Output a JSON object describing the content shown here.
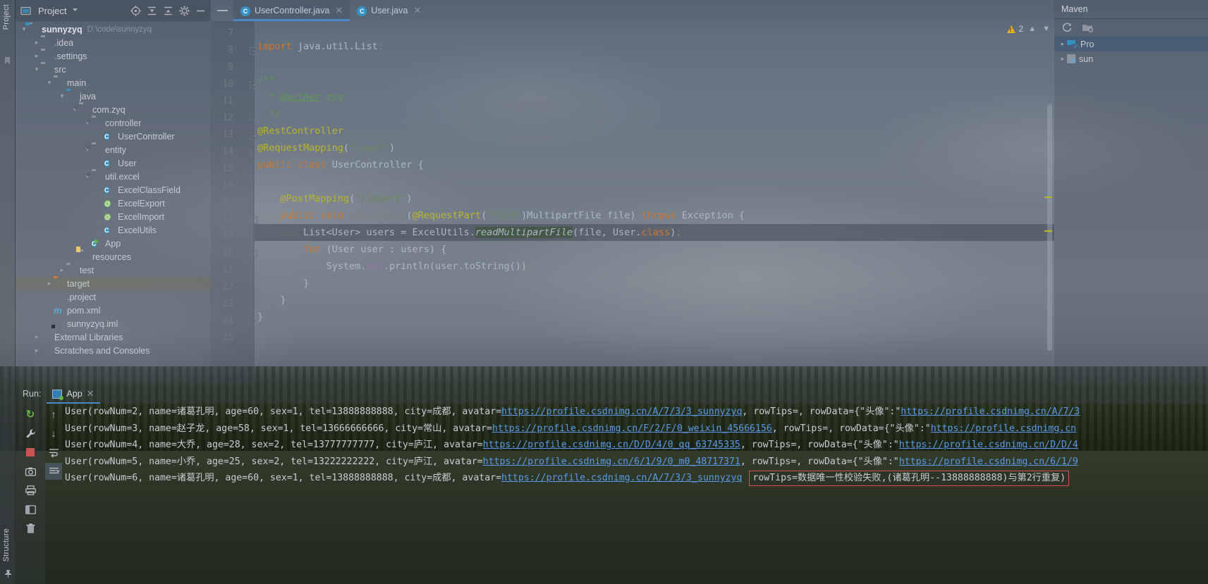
{
  "left_strip": {
    "project_label": "Project",
    "structure_label": "Structure"
  },
  "project_panel": {
    "title": "Project",
    "icons": [
      "project-view-icon",
      "dropdown-arrow-icon",
      "locate-icon",
      "expand-all-icon",
      "collapse-all-icon",
      "settings-gear-icon",
      "hide-icon"
    ],
    "tree": [
      {
        "label": "sunnyzyq",
        "path": "D:\\code\\sunnyzyq",
        "indent": 0,
        "arrow": "v",
        "icon": "module-folder-icon",
        "bold": true
      },
      {
        "label": ".idea",
        "path": "",
        "indent": 1,
        "arrow": ">",
        "icon": "folder-icon",
        "bold": false
      },
      {
        "label": ".settings",
        "path": "",
        "indent": 1,
        "arrow": ">",
        "icon": "folder-icon",
        "bold": false
      },
      {
        "label": "src",
        "path": "",
        "indent": 1,
        "arrow": "v",
        "icon": "folder-icon",
        "bold": false
      },
      {
        "label": "main",
        "path": "",
        "indent": 2,
        "arrow": "v",
        "icon": "folder-icon",
        "bold": false
      },
      {
        "label": "java",
        "path": "",
        "indent": 3,
        "arrow": "v",
        "icon": "source-folder-icon",
        "bold": false
      },
      {
        "label": "com.zyq",
        "path": "",
        "indent": 4,
        "arrow": "v",
        "icon": "package-icon",
        "bold": false
      },
      {
        "label": "controller",
        "path": "",
        "indent": 5,
        "arrow": "v",
        "icon": "package-icon",
        "bold": false
      },
      {
        "label": "UserController",
        "path": "",
        "indent": 6,
        "arrow": "",
        "icon": "java-class-icon",
        "bold": false
      },
      {
        "label": "entity",
        "path": "",
        "indent": 5,
        "arrow": "v",
        "icon": "package-icon",
        "bold": false
      },
      {
        "label": "User",
        "path": "",
        "indent": 6,
        "arrow": "",
        "icon": "java-class-icon",
        "bold": false
      },
      {
        "label": "util.excel",
        "path": "",
        "indent": 5,
        "arrow": "v",
        "icon": "package-icon",
        "bold": false
      },
      {
        "label": "ExcelClassField",
        "path": "",
        "indent": 6,
        "arrow": "",
        "icon": "java-class-icon",
        "bold": false
      },
      {
        "label": "ExcelExport",
        "path": "",
        "indent": 6,
        "arrow": "",
        "icon": "java-annotation-icon",
        "bold": false
      },
      {
        "label": "ExcelImport",
        "path": "",
        "indent": 6,
        "arrow": "",
        "icon": "java-annotation-icon",
        "bold": false
      },
      {
        "label": "ExcelUtils",
        "path": "",
        "indent": 6,
        "arrow": "",
        "icon": "java-class-icon",
        "bold": false
      },
      {
        "label": "App",
        "path": "",
        "indent": 5,
        "arrow": "",
        "icon": "runnable-class-icon",
        "bold": false
      },
      {
        "label": "resources",
        "path": "",
        "indent": 4,
        "arrow": "",
        "icon": "resources-folder-icon",
        "bold": false
      },
      {
        "label": "test",
        "path": "",
        "indent": 3,
        "arrow": ">",
        "icon": "folder-icon",
        "bold": false
      },
      {
        "label": "target",
        "path": "",
        "indent": 2,
        "arrow": ">",
        "icon": "excluded-folder-icon",
        "bold": false,
        "selected": true
      },
      {
        "label": ".project",
        "path": "",
        "indent": 2,
        "arrow": "",
        "icon": "project-file-icon",
        "bold": false
      },
      {
        "label": "pom.xml",
        "path": "",
        "indent": 2,
        "arrow": "",
        "icon": "maven-file-icon",
        "bold": false
      },
      {
        "label": "sunnyzyq.iml",
        "path": "",
        "indent": 2,
        "arrow": "",
        "icon": "iml-file-icon",
        "bold": false
      },
      {
        "label": "External Libraries",
        "path": "",
        "indent": 1,
        "arrow": ">",
        "icon": "libraries-icon",
        "bold": false
      },
      {
        "label": "Scratches and Consoles",
        "path": "",
        "indent": 1,
        "arrow": ">",
        "icon": "scratches-icon",
        "bold": false
      }
    ]
  },
  "editor": {
    "tabs": [
      {
        "label": "UserController.java",
        "icon": "java-class-icon",
        "active": true
      },
      {
        "label": "User.java",
        "icon": "java-class-icon",
        "active": false
      }
    ],
    "inspection": {
      "count": "2",
      "icon": "warning-triangle-icon"
    },
    "first_line_number": 7,
    "lines": [
      {
        "n": 7,
        "fold": "",
        "html": ""
      },
      {
        "n": 8,
        "fold": "t",
        "html": "<span class=\"kw\">import</span> java.util.List<span class=\"dim\">;</span>"
      },
      {
        "n": 9,
        "fold": "",
        "html": ""
      },
      {
        "n": 10,
        "fold": "t",
        "html": "<span class=\"cmt\">/**</span>"
      },
      {
        "n": 11,
        "fold": "",
        "html": "  <span class=\"cmt\">* </span><span class=\"lnk\">@author</span><span class=\"cmt\"> <i>zyq</i></span>"
      },
      {
        "n": 12,
        "fold": "b",
        "html": "  <span class=\"cmt\">*/</span>"
      },
      {
        "n": 13,
        "fold": "t",
        "html": "<span class=\"ann\">@RestController</span>"
      },
      {
        "n": 14,
        "fold": "b",
        "html": "<span class=\"ann\">@RequestMapping</span>(<span class=\"str\">\"/user\"</span>)"
      },
      {
        "n": 15,
        "fold": "",
        "html": "<span class=\"kw\">public</span> <span class=\"kw\">class</span> <span class=\"typ\">UserController</span> {"
      },
      {
        "n": 16,
        "fold": "",
        "html": ""
      },
      {
        "n": 17,
        "fold": "",
        "html": "    <span class=\"ann\">@PostMapping</span>(<span class=\"str\">\"/import\"</span>)"
      },
      {
        "n": 18,
        "fold": "t",
        "html": "    <span class=\"kw\">public</span> <span class=\"kw\">void</span> <span class=\"dim\">importUser</span>(<span class=\"ann\">@RequestPart</span>(<span class=\"str\">\"file\"</span>)MultipartFile file) <span class=\"kw\">throws</span> Exception {"
      },
      {
        "n": 19,
        "fold": "",
        "cur": true,
        "html": "        List&lt;User&gt; users = ExcelUtils.<span class=\"sh\">readMultipartFile</span>(file, User.<span class=\"kw\">class</span>)<span class=\"dim\">;</span>"
      },
      {
        "n": 20,
        "fold": "t",
        "html": "        <span class=\"kw\">for</span> (User user : users) {"
      },
      {
        "n": 21,
        "fold": "",
        "html": "            System.<span class=\"fld\">out</span>.println(user.toString())<span class=\"dim\">;</span>"
      },
      {
        "n": 22,
        "fold": "b",
        "html": "        }"
      },
      {
        "n": 23,
        "fold": "b",
        "html": "    }"
      },
      {
        "n": 24,
        "fold": "",
        "html": "}"
      },
      {
        "n": 25,
        "fold": "",
        "html": ""
      }
    ]
  },
  "maven_panel": {
    "title": "Maven",
    "toolbar_icons": [
      "refresh-icon",
      "add-maven-project-icon"
    ],
    "items": [
      {
        "label": "Pro",
        "icon": "maven-profiles-icon",
        "arrow": ">",
        "selected": true
      },
      {
        "label": "sun",
        "icon": "maven-module-icon",
        "arrow": ">",
        "selected": false
      }
    ]
  },
  "run_panel": {
    "label": "Run:",
    "tab": {
      "label": "App",
      "icon": "run-config-icon"
    },
    "toolbar_icons": [
      "rerun-icon",
      "settings-wrench-icon",
      "stop-icon",
      "camera-icon",
      "export-icon",
      "print-icon",
      "layout-icon",
      "trash-icon",
      "scroll-up-icon",
      "scroll-down-icon",
      "soft-wrap-icon",
      "scroll-to-end-icon"
    ],
    "console_lines": [
      {
        "segments": [
          {
            "t": "User(rowNum=2, name=诸葛孔明, age=60, sex=1, tel=13888888888, city=成都, avatar=",
            "k": "text"
          },
          {
            "t": "https://profile.csdnimg.cn/A/7/3/3_sunnyzyq",
            "k": "link"
          },
          {
            "t": ", rowTips=, rowData={\"头像\":\"",
            "k": "text"
          },
          {
            "t": "https://profile.csdnimg.cn/A/7/3",
            "k": "link"
          }
        ]
      },
      {
        "segments": [
          {
            "t": "User(rowNum=3, name=赵子龙, age=58, sex=1, tel=13666666666, city=常山, avatar=",
            "k": "text"
          },
          {
            "t": "https://profile.csdnimg.cn/F/2/F/0_weixin_45666156",
            "k": "link"
          },
          {
            "t": ", rowTips=, rowData={\"头像\":\"",
            "k": "text"
          },
          {
            "t": "https://profile.csdnimg.cn",
            "k": "link"
          }
        ]
      },
      {
        "segments": [
          {
            "t": "User(rowNum=4, name=大乔, age=28, sex=2, tel=13777777777, city=庐江, avatar=",
            "k": "text"
          },
          {
            "t": "https://profile.csdnimg.cn/D/D/4/0_qq_63745335",
            "k": "link"
          },
          {
            "t": ", rowTips=, rowData={\"头像\":\"",
            "k": "text"
          },
          {
            "t": "https://profile.csdnimg.cn/D/D/4",
            "k": "link"
          }
        ]
      },
      {
        "segments": [
          {
            "t": "User(rowNum=5, name=小乔, age=25, sex=2, tel=13222222222, city=庐江, avatar=",
            "k": "text"
          },
          {
            "t": "https://profile.csdnimg.cn/6/1/9/0_m0_48717371",
            "k": "link"
          },
          {
            "t": ", rowTips=, rowData={\"头像\":\"",
            "k": "text"
          },
          {
            "t": "https://profile.csdnimg.cn/6/1/9",
            "k": "link"
          }
        ]
      },
      {
        "segments": [
          {
            "t": "User(rowNum=6, name=诸葛孔明, age=60, sex=1, tel=13888888888, city=成都, avatar=",
            "k": "text"
          },
          {
            "t": "https://profile.csdnimg.cn/A/7/3/3_sunnyzyq",
            "k": "link"
          },
          {
            "t": " ",
            "k": "text"
          },
          {
            "t": "rowTips=数据唯一性校验失败,(诸葛孔明--13888888888)与第2行重复)",
            "k": "errorbox"
          }
        ]
      }
    ]
  },
  "colors": {
    "accent_blue": "#4a88c7",
    "link_blue": "#5a9ae8",
    "error_red": "#d94f4f",
    "keyword_orange": "#cc7832",
    "string_green": "#6a8759",
    "annotation_yellow": "#bbb529",
    "comment_green": "#629755"
  }
}
